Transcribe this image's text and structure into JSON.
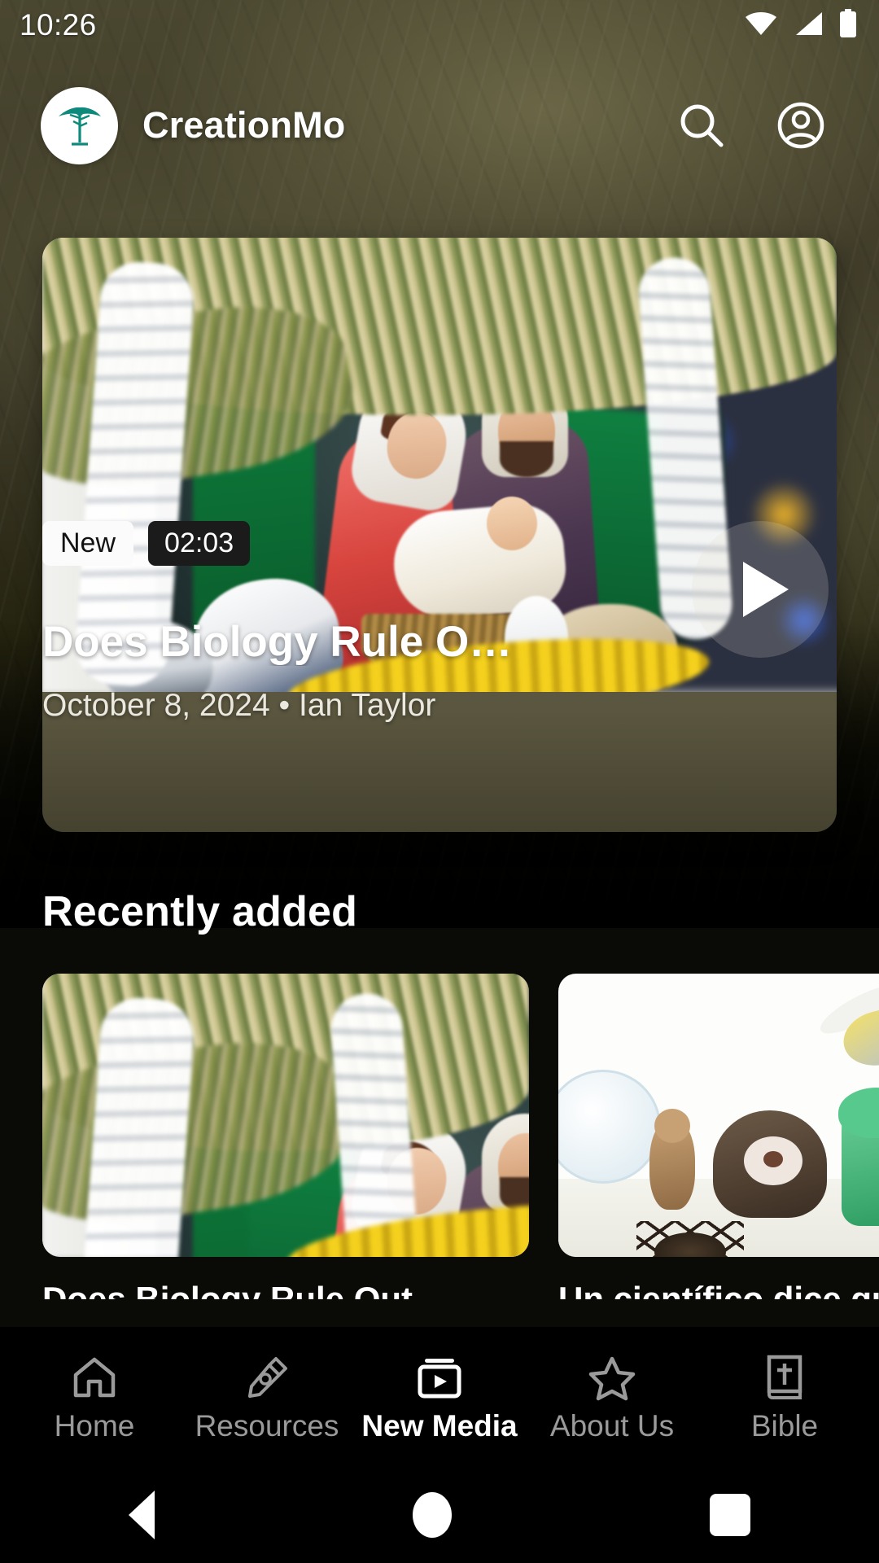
{
  "status_bar": {
    "time": "10:26",
    "icons": [
      "wifi-icon",
      "cellular-signal-icon",
      "battery-icon"
    ]
  },
  "header": {
    "logo_icon": "acacia-tree-logo",
    "brand": "CreationMo",
    "brand_color": "#ffffff",
    "logo_color": "#0e8a7d",
    "actions": [
      {
        "icon": "search-icon",
        "label": "Search"
      },
      {
        "icon": "account-circle-icon",
        "label": "Account"
      }
    ]
  },
  "featured": {
    "badge_new": "New",
    "duration": "02:03",
    "title": "Does Biology Rule O…",
    "subtitle": "October 8, 2024 • Ian Taylor",
    "date": "October 8, 2024",
    "author": "Ian Taylor",
    "play_icon": "play-icon",
    "thumbnail_alt": "nativity-scene"
  },
  "recently_added": {
    "heading": "Recently added",
    "items": [
      {
        "title": "Does Biology Rule Out",
        "thumbnail_alt": "nativity-scene"
      },
      {
        "title": "Un científico dice que",
        "thumbnail_alt": "group-of-animals"
      }
    ]
  },
  "bottom_nav": {
    "active": "New Media",
    "items": [
      {
        "label": "Home",
        "icon": "home-icon",
        "active": false
      },
      {
        "label": "Resources",
        "icon": "pen-nib-icon",
        "active": false
      },
      {
        "label": "New Media",
        "icon": "media-play-icon",
        "active": true
      },
      {
        "label": "About Us",
        "icon": "star-icon",
        "active": false
      },
      {
        "label": "Bible",
        "icon": "bible-book-icon",
        "active": false
      }
    ],
    "inactive_color": "#9a9a9a",
    "active_color": "#ffffff"
  },
  "system_nav": {
    "items": [
      {
        "label": "Back",
        "icon": "triangle-back-icon"
      },
      {
        "label": "Home",
        "icon": "circle-home-icon"
      },
      {
        "label": "Recents",
        "icon": "square-recents-icon"
      }
    ]
  }
}
